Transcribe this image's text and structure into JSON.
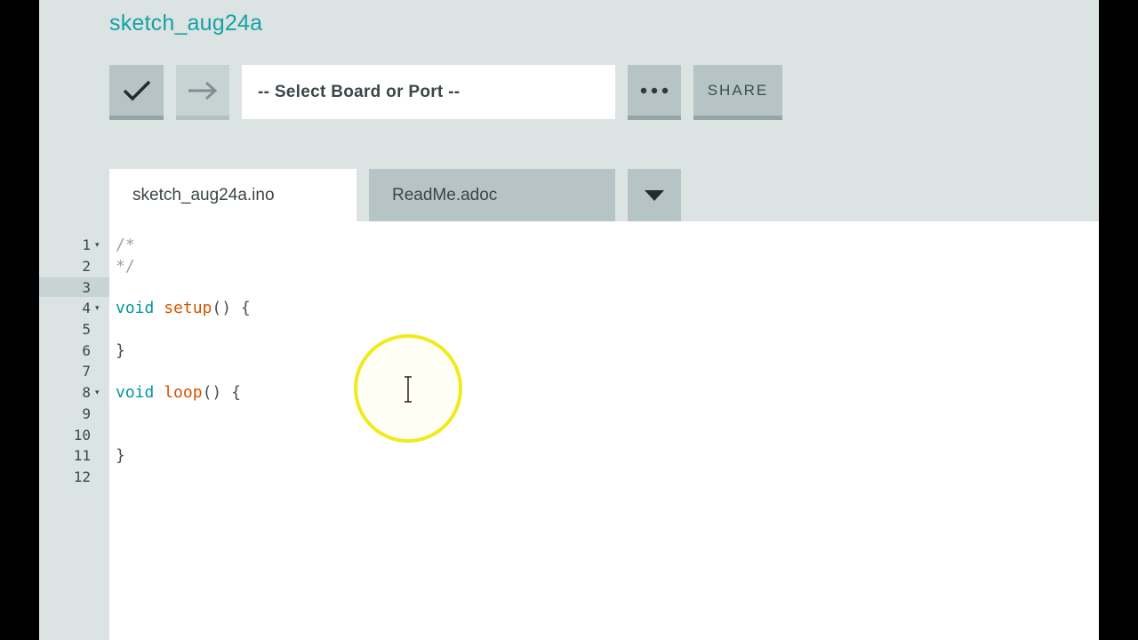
{
  "sketch": {
    "title": "sketch_aug24a"
  },
  "toolbar": {
    "verify_icon": "checkmark-icon",
    "upload_icon": "arrow-right-icon",
    "board_select_value": "-- Select Board or Port --",
    "more_icon": "ellipsis-icon",
    "share_label": "SHARE"
  },
  "tabs": [
    {
      "label": "sketch_aug24a.ino",
      "active": true
    },
    {
      "label": "ReadMe.adoc",
      "active": false
    }
  ],
  "tab_dropdown_icon": "caret-down-icon",
  "editor": {
    "line_numbers": [
      "1",
      "2",
      "3",
      "4",
      "5",
      "6",
      "7",
      "8",
      "9",
      "10",
      "11",
      "12"
    ],
    "folds": [
      "▾",
      "▾",
      "▾"
    ],
    "lines": {
      "l1": "/*",
      "l2": "*/",
      "l4_kw": "void",
      "l4_fn": "setup",
      "l4_rest": "() {",
      "l6": "}",
      "l8_kw": "void",
      "l8_fn": "loop",
      "l8_rest": "() {",
      "l11": "}"
    }
  },
  "colors": {
    "accent": "#17a1a5",
    "keyword": "#00979c",
    "function": "#d35400",
    "comment": "#95a5a6",
    "panel": "#dbe3e3",
    "button": "#b6c4c6",
    "cursor_highlight": "#f0eb1c"
  }
}
